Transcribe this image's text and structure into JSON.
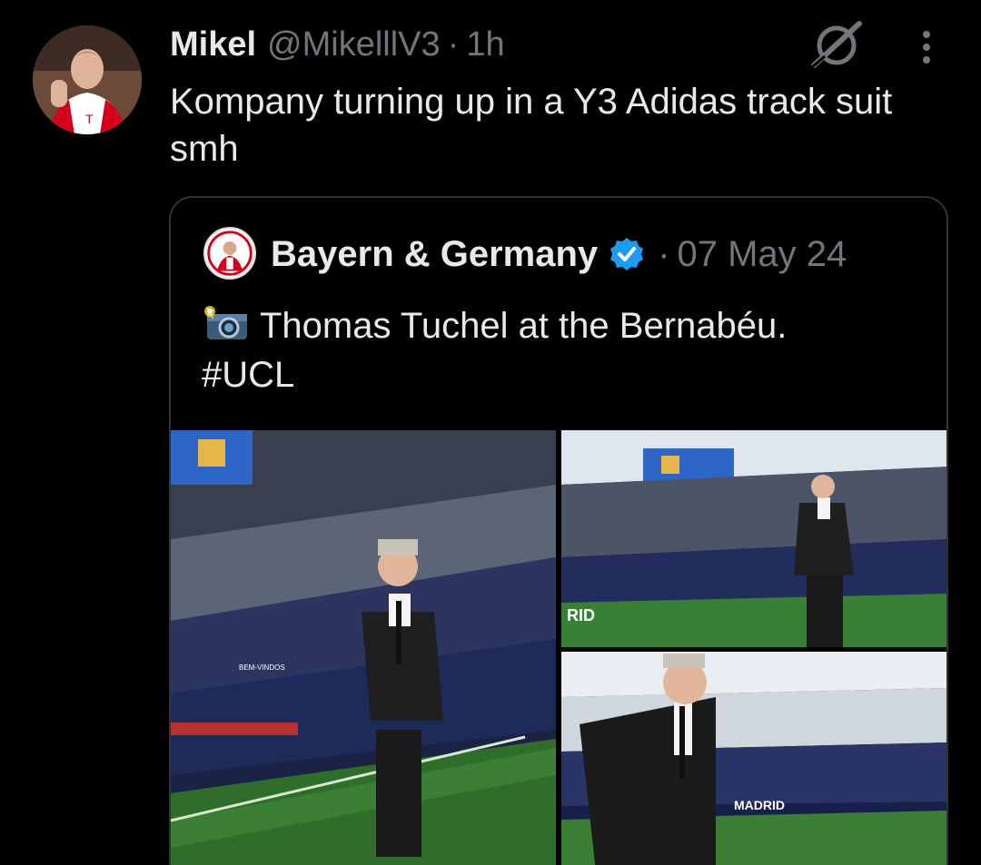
{
  "post": {
    "author_name": "Mikel",
    "author_handle": "@MikelllV3",
    "separator": "·",
    "time_ago": "1h",
    "text": "Kompany turning up in a Y3 Adidas track suit smh",
    "avatar_icon": "profile-photo"
  },
  "quoted_post": {
    "author_name": "Bayern & Germany",
    "verified_icon": "verified-badge-icon",
    "verified_color": "#1d9bf0",
    "separator": "·",
    "date": "07 May 24",
    "emoji_icon": "camera-with-flash-icon",
    "text_line1": "Thomas Tuchel at the Bernabéu.",
    "text_line2": "#UCL",
    "photos": [
      {
        "caption_visible": "BEM-VINDOS"
      },
      {
        "caption_visible": "RID"
      },
      {
        "caption_visible": "MADRID"
      }
    ]
  },
  "colors": {
    "background": "#000000",
    "primary_text": "#e7e9ea",
    "secondary_text": "#71767b",
    "border": "#2f3336"
  },
  "icons": {
    "grok": "grok-icon",
    "more": "more-vertical-icon"
  }
}
